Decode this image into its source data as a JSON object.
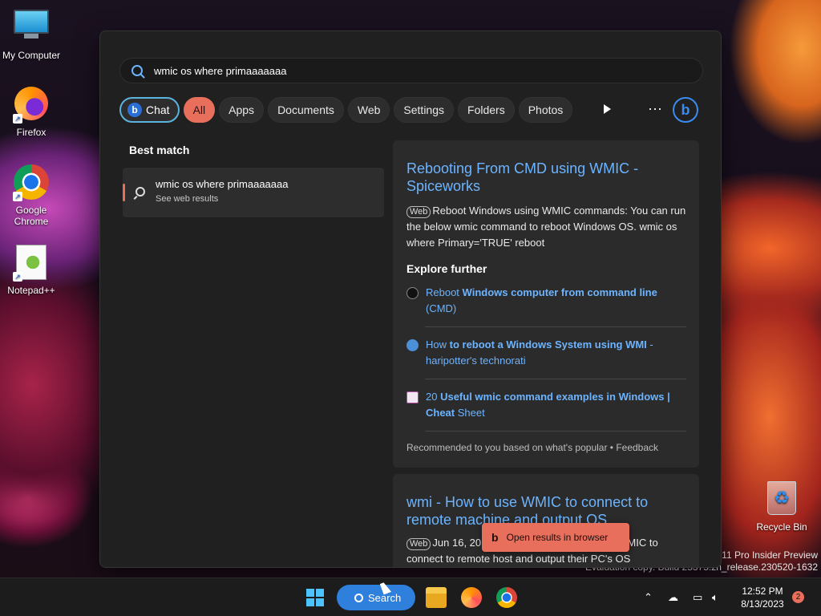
{
  "desktop": {
    "icons": [
      {
        "label": "My Computer",
        "icon": "computer-icon"
      },
      {
        "label": "Firefox",
        "icon": "firefox-icon"
      },
      {
        "label": "Google Chrome",
        "icon": "chrome-icon"
      },
      {
        "label": "Notepad++",
        "icon": "notepadpp-icon"
      },
      {
        "label": "Recycle Bin",
        "icon": "recycle-bin-icon"
      }
    ],
    "watermark": {
      "line1": "s 11 Pro Insider Preview",
      "line2": "Evaluation copy. Build 25375.zn_release.230520-1632"
    }
  },
  "search": {
    "query": "wmic os where primaaaaaaa",
    "filters": [
      "Chat",
      "All",
      "Apps",
      "Documents",
      "Web",
      "Settings",
      "Folders",
      "Photos"
    ],
    "active_filter": "All",
    "more_label": "···",
    "bing_label": "b"
  },
  "best_match": {
    "heading": "Best match",
    "title": "wmic os where primaaaaaaa",
    "subtitle": "See web results"
  },
  "result1": {
    "title": "Rebooting From CMD using WMIC - Spiceworks",
    "tag": "Web",
    "snippet": "Reboot Windows using WMIC commands: You can run the below wmic command to reboot Windows OS. wmic os where Primary='TRUE' reboot",
    "explore_heading": "Explore further",
    "explore": [
      {
        "pre": "Reboot ",
        "bold": "Windows computer from command line",
        "post": " (CMD)"
      },
      {
        "pre": "How ",
        "bold": "to reboot a Windows System using WMI",
        "post": " - haripotter's technorati"
      },
      {
        "pre": "20 ",
        "bold": "Useful wmic command examples in Windows | Cheat",
        "post": " Sheet"
      }
    ],
    "footer": "Recommended to you based on what's popular • Feedback"
  },
  "result2": {
    "title": "wmi - How to use WMIC to connect to remote machine and output OS",
    "tag": "Web",
    "date": "Jun 16, 20",
    "snippet_end": "WMIC to",
    "snippet_line2": "connect to remote host and output their PC's OS"
  },
  "toast": {
    "label": "Open results in browser"
  },
  "taskbar": {
    "search_label": "Search",
    "time": "12:52 PM",
    "date": "8/13/2023",
    "notifications": "2"
  }
}
